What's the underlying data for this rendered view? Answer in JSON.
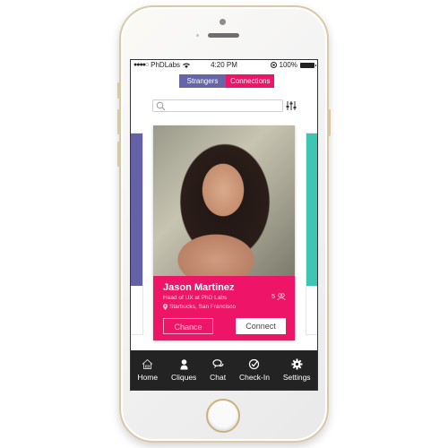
{
  "status_bar": {
    "signal": "●●●●○",
    "carrier": "PhDLabs",
    "wifi_icon": "wifi-icon",
    "time": "4:20 PM",
    "lock_icon": "rotation-lock-icon",
    "battery": "100%"
  },
  "segmented_control": {
    "options": [
      {
        "label": "Strangers",
        "color": "#6565a8"
      },
      {
        "label": "Connections",
        "color": "#ee1568"
      }
    ]
  },
  "search": {
    "placeholder": "",
    "value": "",
    "icon": "search-icon",
    "filter_icon": "filter-sliders-icon"
  },
  "card": {
    "name": "Jason Martinez",
    "title": "Head of UX at PhD Labs",
    "location": "Starbucks, San Francisco",
    "connections_count": "5",
    "chance_label": "Chance",
    "connect_label": "Connect",
    "accent": "#ee1568"
  },
  "side_cards": {
    "left_color": "#6561a7",
    "right_color": "#3ec6b3"
  },
  "tab_bar": {
    "items": [
      {
        "label": "Home",
        "icon": "home-icon"
      },
      {
        "label": "Cliques",
        "icon": "person-icon"
      },
      {
        "label": "Chat",
        "icon": "chat-icon"
      },
      {
        "label": "Check-In",
        "icon": "check-circle-icon"
      },
      {
        "label": "Settings",
        "icon": "gear-icon"
      }
    ]
  }
}
